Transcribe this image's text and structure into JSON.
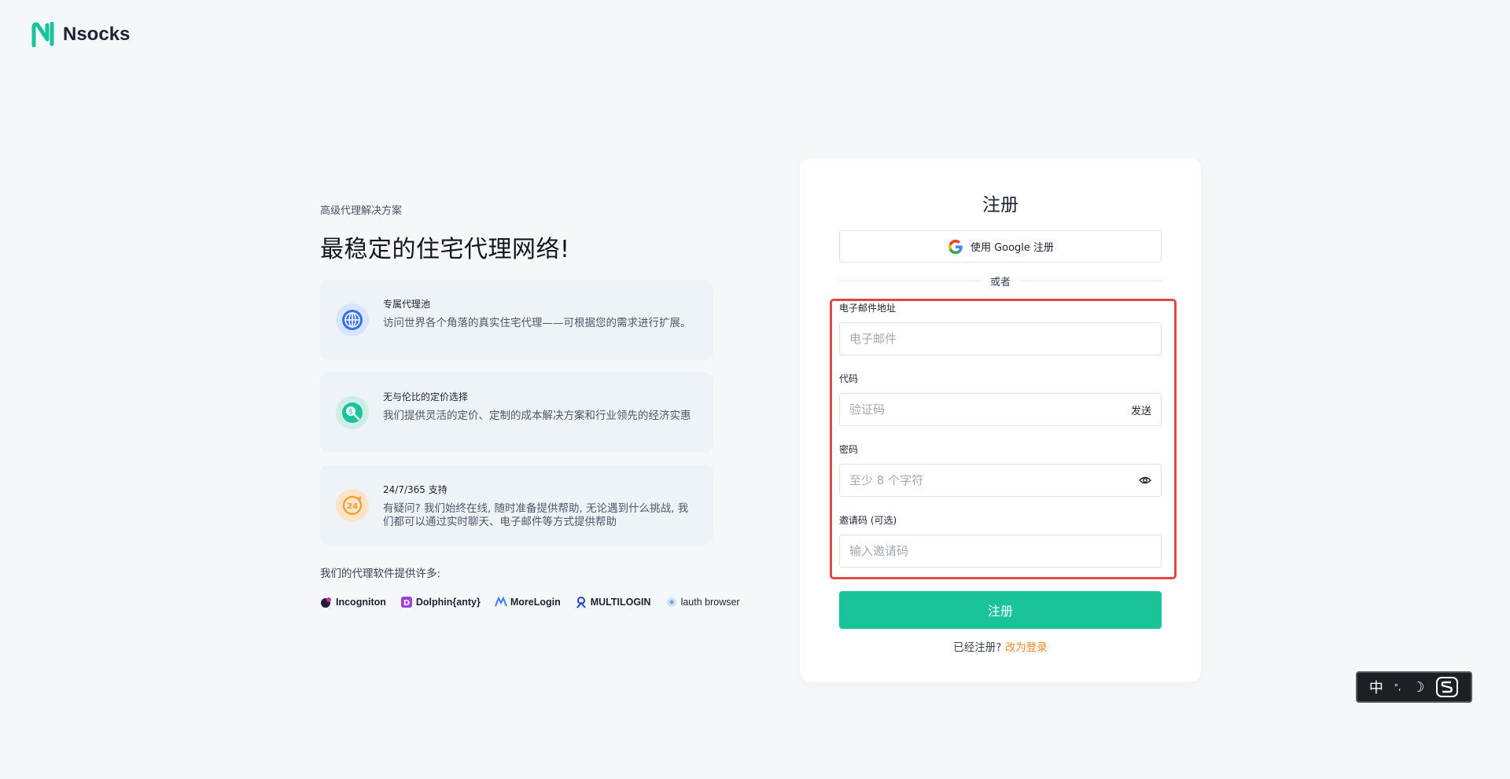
{
  "brand": {
    "name": "Nsocks",
    "accent": "#1bc39a"
  },
  "hero": {
    "kicker": "高级代理解决方案",
    "title": "最稳定的住宅代理网络!",
    "features": [
      {
        "icon": "globe-icon",
        "title": "专属代理池",
        "desc": "访问世界各个角落的真实住宅代理——可根据您的需求进行扩展。"
      },
      {
        "icon": "search-price-icon",
        "title": "无与伦比的定价选择",
        "desc": "我们提供灵活的定价、定制的成本解决方案和行业领先的经济实惠"
      },
      {
        "icon": "support-24-icon",
        "title": "24/7/365 支持",
        "desc": "有疑问? 我们始终在线, 随时准备提供帮助, 无论遇到什么挑战, 我们都可以通过实时聊天、电子邮件等方式提供帮助"
      }
    ],
    "partners_label": "我们的代理软件提供许多:",
    "partners": [
      "Incogniton",
      "Dolphin{anty}",
      "MoreLogin",
      "MULTILOGIN",
      "lauth browser"
    ]
  },
  "form": {
    "title": "注册",
    "google_label": "使用 Google 注册",
    "divider": "或者",
    "email_label": "电子邮件地址",
    "email_placeholder": "电子邮件",
    "code_label": "代码",
    "code_placeholder": "验证码",
    "send_label": "发送",
    "password_label": "密码",
    "password_placeholder": "至少 8 个字符",
    "invite_label": "邀请码 (可选)",
    "invite_placeholder": "输入邀请码",
    "submit_label": "注册",
    "already_text": "已经注册?",
    "login_link": "改为登录"
  },
  "ime": {
    "lang": "中",
    "punct": "°,",
    "moon": "☽"
  }
}
